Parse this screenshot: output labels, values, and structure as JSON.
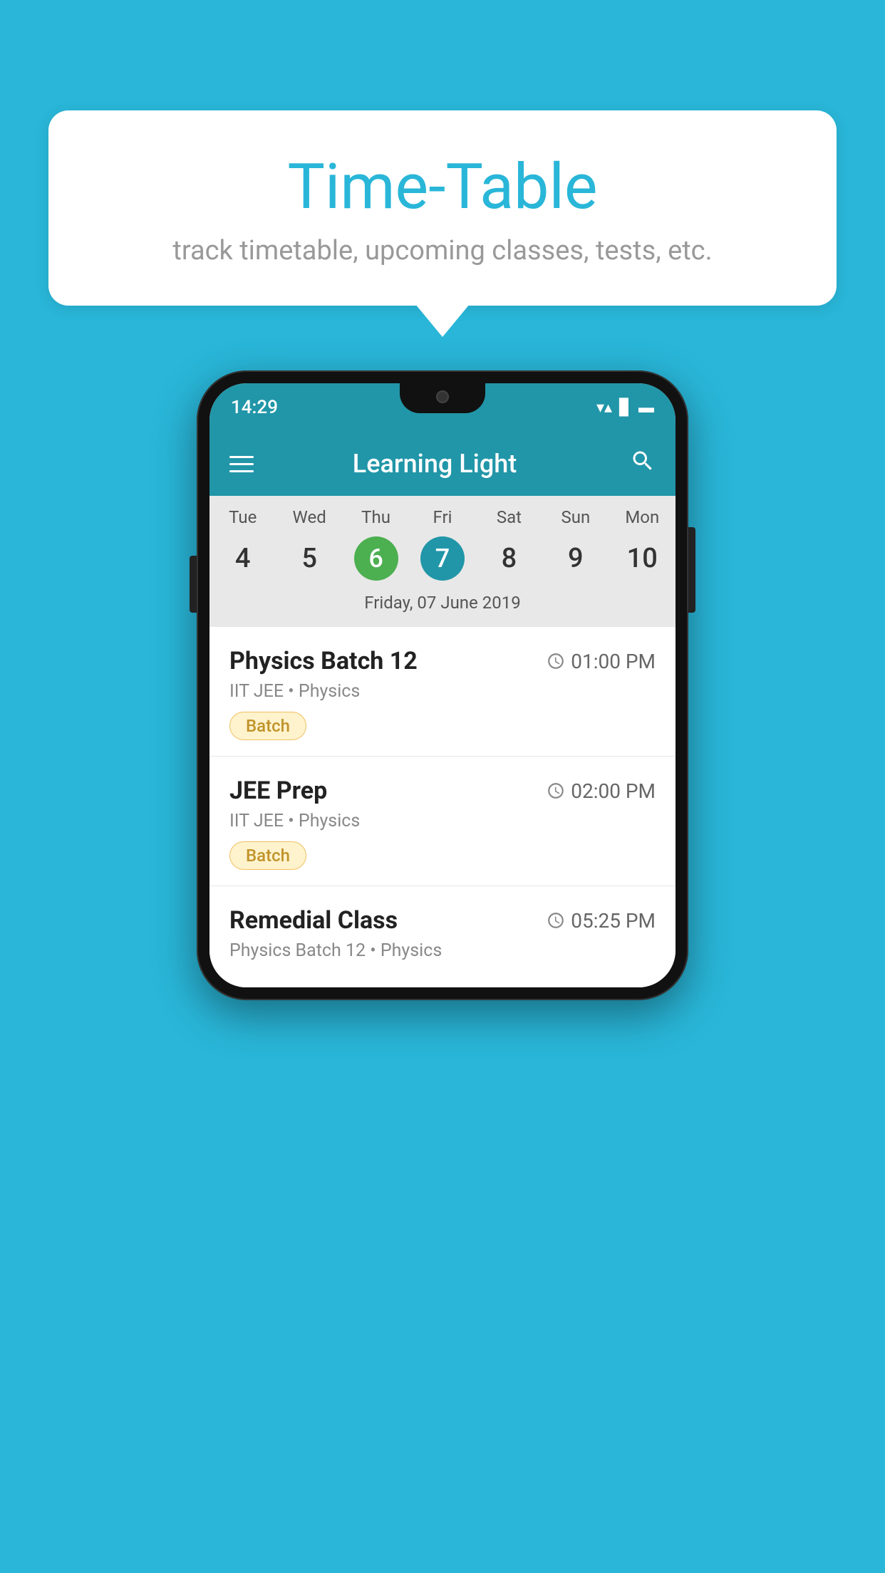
{
  "background_color": "#29b6d8",
  "bubble": {
    "title": "Time-Table",
    "subtitle": "track timetable, upcoming classes, tests, etc."
  },
  "status_bar": {
    "time": "14:29",
    "icons": [
      "wifi",
      "signal",
      "battery"
    ]
  },
  "app_bar": {
    "title": "Learning Light",
    "search_icon": "🔍",
    "menu_label": "menu"
  },
  "calendar": {
    "days": [
      "Tue",
      "Wed",
      "Thu",
      "Fri",
      "Sat",
      "Sun",
      "Mon"
    ],
    "dates": [
      "4",
      "5",
      "6",
      "7",
      "8",
      "9",
      "10"
    ],
    "today_index": 2,
    "selected_index": 3,
    "selected_date_label": "Friday, 07 June 2019"
  },
  "schedule": [
    {
      "name": "Physics Batch 12",
      "time": "01:00 PM",
      "meta": "IIT JEE • Physics",
      "badge": "Batch"
    },
    {
      "name": "JEE Prep",
      "time": "02:00 PM",
      "meta": "IIT JEE • Physics",
      "badge": "Batch"
    },
    {
      "name": "Remedial Class",
      "time": "05:25 PM",
      "meta": "Physics Batch 12 • Physics",
      "badge": null
    }
  ]
}
